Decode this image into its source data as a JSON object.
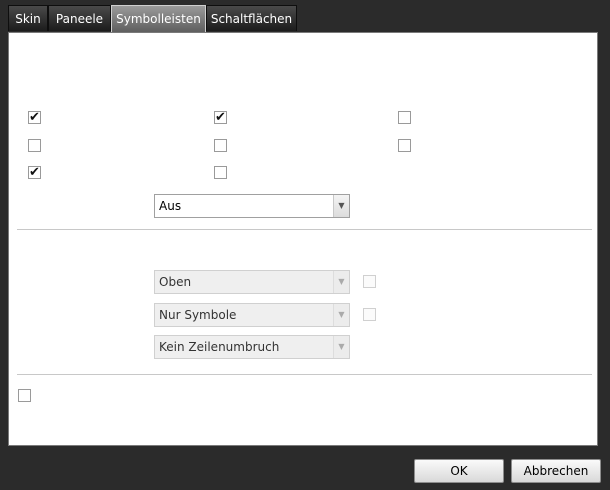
{
  "tabs": [
    {
      "label": "Skin",
      "active": false
    },
    {
      "label": "Paneele",
      "active": false
    },
    {
      "label": "Symbolleisten",
      "active": true
    },
    {
      "label": "Schaltflächen",
      "active": false
    }
  ],
  "checkboxes": {
    "row1": {
      "col1": true,
      "col2": true,
      "col3": false
    },
    "row2": {
      "col1": false,
      "col2": false,
      "col3": false
    },
    "row3": {
      "col1": true,
      "col2": false
    },
    "bottom": false
  },
  "combo_main": {
    "value": "Aus"
  },
  "combo_position": {
    "value": "Oben",
    "enabled": false
  },
  "combo_style": {
    "value": "Nur Symbole",
    "enabled": false
  },
  "combo_wrap": {
    "value": "Kein Zeilenumbruch",
    "enabled": false
  },
  "buttons": {
    "ok": "OK",
    "cancel": "Abbrechen"
  },
  "icons": {
    "dropdown": "chevron-down-icon",
    "check": "checkmark-icon"
  }
}
